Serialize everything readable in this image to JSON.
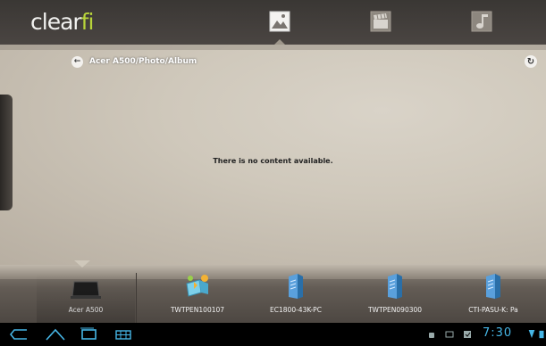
{
  "app": {
    "logo_main": "clear",
    "logo_accent": "fi",
    "tabs": [
      {
        "icon": "photo-icon",
        "label": ""
      },
      {
        "icon": "video-icon",
        "label": ""
      },
      {
        "icon": "music-icon",
        "label": ""
      }
    ]
  },
  "path": {
    "text": "Acer A500/Photo/Album"
  },
  "content": {
    "empty_message": "There is no content available."
  },
  "devices": [
    {
      "name": "Acer A500",
      "icon": "tablet-icon"
    },
    {
      "name": "TWTPEN100107",
      "icon": "media-player-icon"
    },
    {
      "name": "EC1800-43K-PC",
      "icon": "server-icon"
    },
    {
      "name": "TWTPEN090300",
      "icon": "server-icon"
    },
    {
      "name": "CTI-PASU-K: Pa",
      "icon": "server-icon"
    }
  ],
  "statusbar": {
    "time": "7:30"
  },
  "colors": {
    "accent": "#b8d43a",
    "time": "#46b6e6"
  }
}
